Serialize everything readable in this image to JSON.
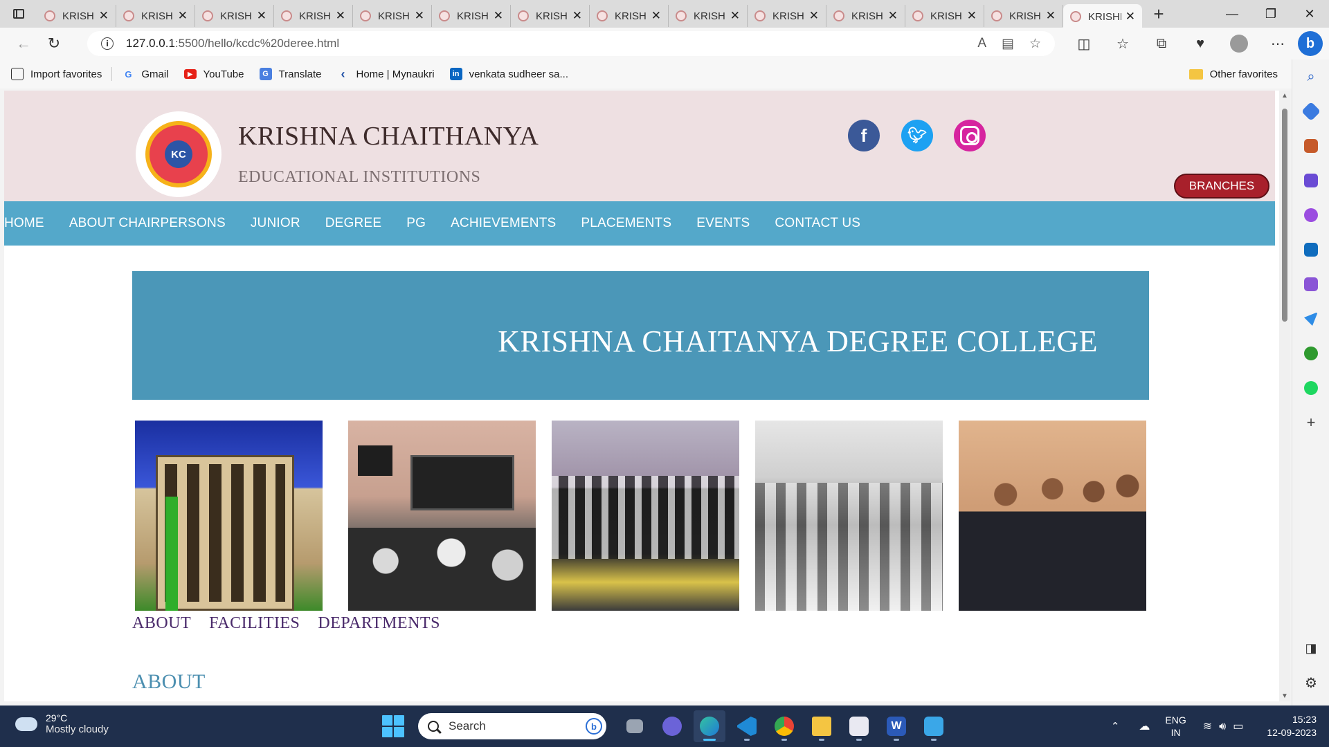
{
  "browser": {
    "tabs": [
      {
        "title": "KRISHNA"
      },
      {
        "title": "KRISHNA"
      },
      {
        "title": "KRISHNA"
      },
      {
        "title": "KRISHNA"
      },
      {
        "title": "KRISHNA"
      },
      {
        "title": "KRISHNA"
      },
      {
        "title": "KRISHNA"
      },
      {
        "title": "KRISHNA"
      },
      {
        "title": "KRISHNA"
      },
      {
        "title": "KRISHNA"
      },
      {
        "title": "KRISHNA"
      },
      {
        "title": "KRISHNA"
      },
      {
        "title": "KRISHNA"
      },
      {
        "title": "KRISHNA"
      }
    ],
    "url_host": "127.0.0.1",
    "url_path": ":5500/hello/kcdc%20deree.html",
    "bookmarks": [
      {
        "label": "Import favorites",
        "icon": "import-icon"
      },
      {
        "label": "Gmail",
        "icon": "google-icon"
      },
      {
        "label": "YouTube",
        "icon": "youtube-icon"
      },
      {
        "label": "Translate",
        "icon": "translate-icon"
      },
      {
        "label": "Home | Mynaukri",
        "icon": "mynaukri-icon"
      },
      {
        "label": "venkata sudheer sa...",
        "icon": "linkedin-icon"
      }
    ],
    "other_favorites": "Other favorites"
  },
  "site": {
    "brand_title": "KRISHNA CHAITHANYA",
    "brand_subtitle": "EDUCATIONAL INSTITUTIONS",
    "logo_text": "KC",
    "social": {
      "facebook": "f",
      "twitter": "t"
    },
    "branches_label": "BRANCHES",
    "nav": [
      "HOME",
      "ABOUT CHAIRPERSONS",
      "JUNIOR",
      "DEGREE",
      "PG",
      "ACHIEVEMENTS",
      "PLACEMENTS",
      "EVENTS",
      "CONTACT US"
    ],
    "banner_title": "KRISHNA CHAITANYA DEGREE COLLEGE",
    "subnav": [
      "ABOUT",
      "FACILITIES",
      "DEPARTMENTS"
    ],
    "section_heading": "ABOUT",
    "colors": {
      "header_bg": "#eee0e2",
      "nav_bg": "#54a8ca",
      "banner_bg": "#4b97b8",
      "branches_bg": "#a8202b"
    }
  },
  "taskbar": {
    "temperature": "29°C",
    "weather": "Mostly cloudy",
    "search_placeholder": "Search",
    "language": "ENG",
    "region": "IN",
    "time": "15:23",
    "date": "12-09-2023"
  }
}
